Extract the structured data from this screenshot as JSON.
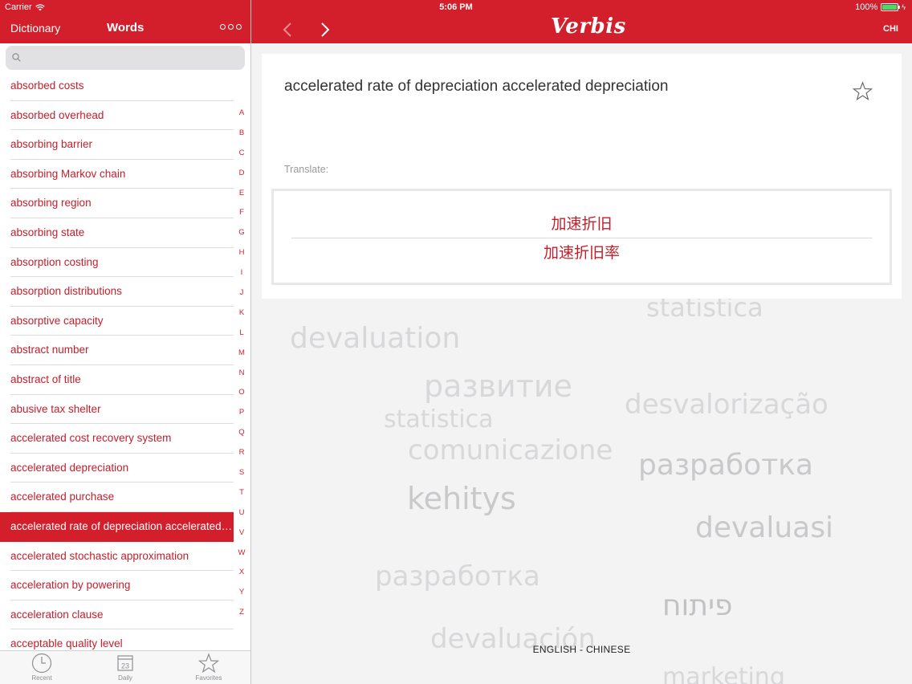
{
  "status_bar": {
    "carrier": "Carrier",
    "time": "5:06 PM",
    "battery": "100%",
    "battery_level": 1.0
  },
  "nav": {
    "dictionary_label": "Dictionary",
    "title": "Words",
    "logo": "Verbis",
    "language_code": "CHI"
  },
  "search": {
    "placeholder": ""
  },
  "word_list": [
    "absorbed costs",
    "absorbed overhead",
    "absorbing barrier",
    "absorbing Markov chain",
    "absorbing region",
    "absorbing state",
    "absorption costing",
    "absorption distributions",
    "absorptive capacity",
    "abstract number",
    "abstract of title",
    "abusive tax shelter",
    "accelerated cost recovery system",
    "accelerated depreciation",
    "accelerated purchase",
    "accelerated rate of depreciation accelerated depreciation",
    "accelerated stochastic approximation",
    "acceleration by powering",
    "acceleration clause",
    "acceptable quality level"
  ],
  "selected_index": 15,
  "alphabet": [
    "A",
    "B",
    "C",
    "D",
    "E",
    "F",
    "G",
    "H",
    "I",
    "J",
    "K",
    "L",
    "M",
    "N",
    "O",
    "P",
    "Q",
    "R",
    "S",
    "T",
    "U",
    "V",
    "W",
    "X",
    "Y",
    "Z"
  ],
  "tabs": [
    {
      "label": "Recent",
      "icon": "clock-icon"
    },
    {
      "label": "Daily",
      "icon": "calendar-icon",
      "day": "23"
    },
    {
      "label": "Favorites",
      "icon": "star-icon"
    }
  ],
  "entry": {
    "term": "accelerated rate of depreciation accelerated depreciation",
    "translate_label": "Translate:",
    "translations": [
      "加速折旧",
      "加速折旧率"
    ]
  },
  "background_words": [
    "statistica",
    "devaluation",
    "развитие",
    "desvalorização",
    "statistica",
    "comunicazione",
    "разработка",
    "kehitys",
    "devaluasi",
    "разработка",
    "פיתוח",
    "devaluación",
    "marketing"
  ],
  "language_pair": "ENGLISH - CHINESE",
  "colors": {
    "accent": "#d21f2b",
    "text_red": "#c41e2a",
    "background": "#f3f3f4"
  }
}
